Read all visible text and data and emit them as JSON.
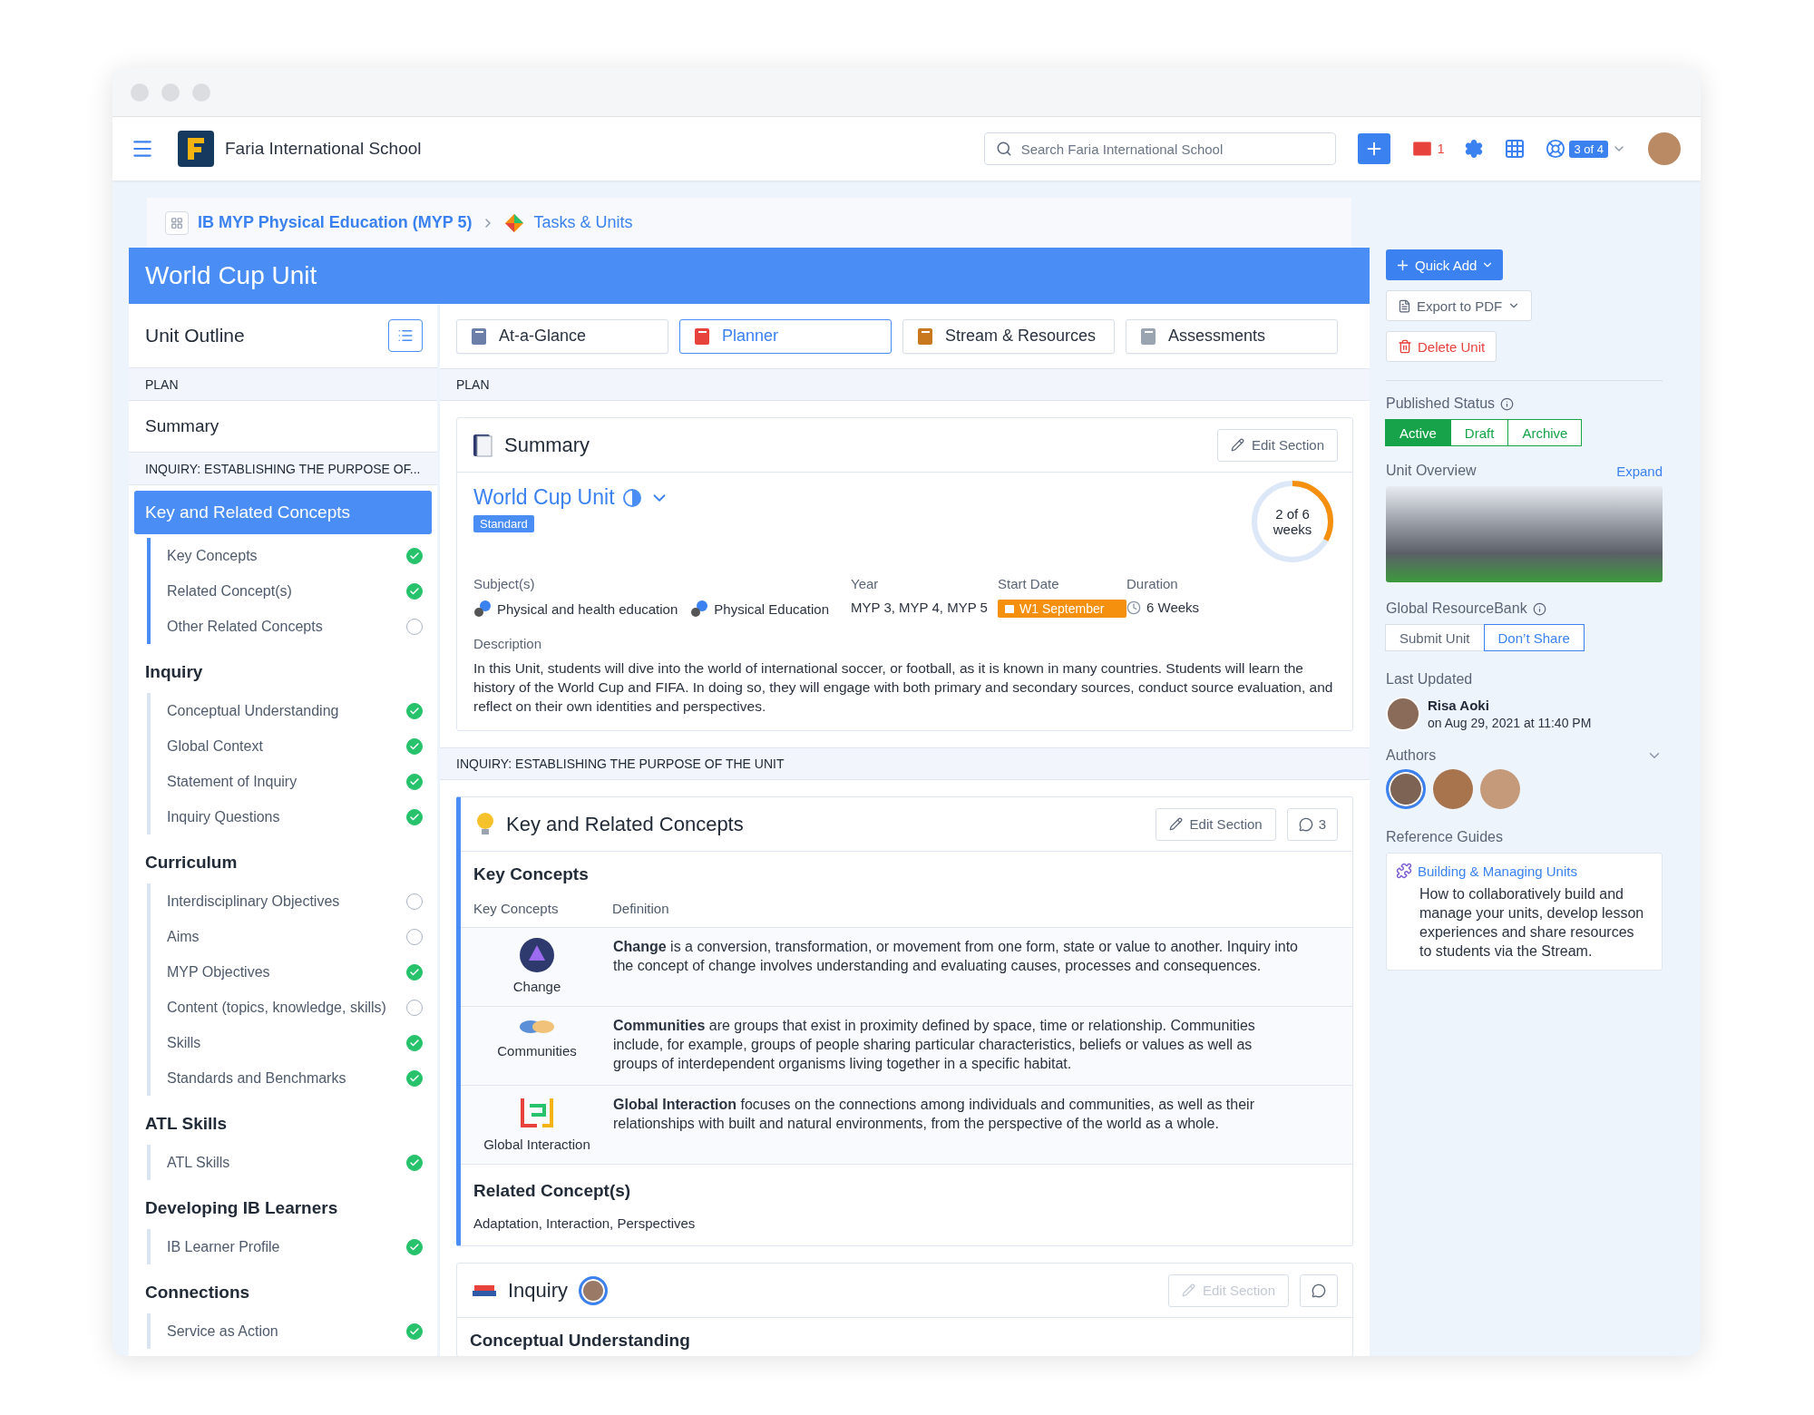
{
  "header": {
    "school": "Faria International School",
    "search": {
      "placeholder": "Search Faria International School"
    },
    "mail_count": "1",
    "account_badge": "3 of 4"
  },
  "breadcrumb": [
    {
      "label": "IB MYP Physical Education (MYP 5)"
    },
    {
      "label": "Tasks & Units"
    }
  ],
  "unit_title": "World Cup Unit",
  "sidebar": {
    "title": "Unit Outline",
    "sections": [
      {
        "kind": "band",
        "label": "PLAN"
      },
      {
        "kind": "link",
        "label": "Summary"
      },
      {
        "kind": "band",
        "label": "INQUIRY: ESTABLISHING THE PURPOSE OF..."
      },
      {
        "kind": "group",
        "label": "Key and Related Concepts",
        "selected": true,
        "children": [
          {
            "label": "Key Concepts",
            "checked": true
          },
          {
            "label": "Related Concept(s)",
            "checked": true
          },
          {
            "label": "Other Related Concepts",
            "checked": false
          }
        ]
      },
      {
        "kind": "group",
        "label": "Inquiry",
        "selected": false,
        "children": [
          {
            "label": "Conceptual Understanding",
            "checked": true
          },
          {
            "label": "Global Context",
            "checked": true
          },
          {
            "label": "Statement of Inquiry",
            "checked": true
          },
          {
            "label": "Inquiry Questions",
            "checked": true
          }
        ]
      },
      {
        "kind": "group",
        "label": "Curriculum",
        "selected": false,
        "children": [
          {
            "label": "Interdisciplinary Objectives",
            "checked": false
          },
          {
            "label": "Aims",
            "checked": false
          },
          {
            "label": "MYP Objectives",
            "checked": true
          },
          {
            "label": "Content (topics, knowledge, skills)",
            "checked": false
          },
          {
            "label": "Skills",
            "checked": true
          },
          {
            "label": "Standards and Benchmarks",
            "checked": true
          }
        ]
      },
      {
        "kind": "group",
        "label": "ATL Skills",
        "selected": false,
        "children": [
          {
            "label": "ATL Skills",
            "checked": true
          }
        ]
      },
      {
        "kind": "group",
        "label": "Developing IB Learners",
        "selected": false,
        "children": [
          {
            "label": "IB Learner Profile",
            "checked": true
          }
        ]
      },
      {
        "kind": "group",
        "label": "Connections",
        "selected": false,
        "children": [
          {
            "label": "Service as Action",
            "checked": true
          }
        ]
      }
    ]
  },
  "tabs": [
    {
      "label": "At-a-Glance",
      "selected": false
    },
    {
      "label": "Planner",
      "selected": true
    },
    {
      "label": "Stream & Resources",
      "selected": false
    },
    {
      "label": "Assessments",
      "selected": false
    }
  ],
  "plan_band": "PLAN",
  "summary": {
    "title": "Summary",
    "edit": "Edit Section",
    "unit_name": "World Cup Unit",
    "tag": "Standard",
    "progress": {
      "count": "2 of 6",
      "unit": "weeks",
      "level": 0.33
    },
    "subjects": {
      "label": "Subject(s)",
      "items": [
        "Physical and health education",
        "Physical Education"
      ]
    },
    "year": {
      "label": "Year",
      "value": "MYP 3, MYP 4, MYP 5"
    },
    "start": {
      "label": "Start Date",
      "value": "W1 September"
    },
    "duration": {
      "label": "Duration",
      "value": "6 Weeks"
    },
    "description": {
      "label": "Description",
      "text": "In this Unit, students will dive into the world of international soccer, or football, as it is known in many countries. Students will learn the history of the World Cup and FIFA. In doing so, they will engage with both primary and secondary sources, conduct source evaluation, and reflect on their own identities and perspectives."
    }
  },
  "inquiry_band": "INQUIRY: ESTABLISHING THE PURPOSE OF THE UNIT",
  "concepts": {
    "title": "Key and Related Concepts",
    "edit": "Edit Section",
    "comments": "3",
    "heading": "Key Concepts",
    "columns": [
      "Key Concepts",
      "Definition"
    ],
    "rows": [
      {
        "name": "Change",
        "definition": "**Change** is a conversion, transformation, or movement from one form, state or value to another. Inquiry into the concept of change involves understanding and evaluating causes, processes and consequences."
      },
      {
        "name": "Communities",
        "definition": "**Communities** are groups that exist in proximity defined by space, time or relationship. Communities include, for example, groups of people sharing particular characteristics, beliefs or values as well as groups of interdependent organisms living together in a specific habitat."
      },
      {
        "name": "Global Interaction",
        "definition": "**Global Interaction** focuses on the connections among individuals and communities, as well as their relationships with built and natural environments, from the perspective of the world as a whole."
      }
    ],
    "related_heading": "Related Concept(s)",
    "related": "Adaptation, Interaction, Perspectives"
  },
  "inquiry": {
    "title": "Inquiry",
    "edit": "Edit Section",
    "edit_disabled": true,
    "heading": "Conceptual Understanding"
  },
  "actions": {
    "quick_add": "Quick Add",
    "export": "Export to PDF",
    "delete": "Delete Unit"
  },
  "published": {
    "label": "Published Status",
    "options": [
      {
        "label": "Active",
        "selected": true
      },
      {
        "label": "Draft",
        "selected": false
      },
      {
        "label": "Archive",
        "selected": false
      }
    ]
  },
  "overview": {
    "label": "Unit Overview",
    "expand": "Expand"
  },
  "resource_bank": {
    "label": "Global ResourceBank",
    "options": [
      {
        "label": "Submit Unit",
        "selected": false
      },
      {
        "label": "Don’t Share",
        "selected": true
      }
    ]
  },
  "last_updated": {
    "label": "Last Updated",
    "name": "Risa Aoki",
    "time": "on Aug 29, 2021 at 11:40 PM"
  },
  "authors": {
    "label": "Authors",
    "people": [
      {
        "selected": true
      },
      {
        "selected": false
      },
      {
        "selected": false
      }
    ]
  },
  "reference": {
    "label": "Reference Guides",
    "link": "Building & Managing Units",
    "text": "How to collaboratively build and manage your units, develop lesson experiences and share resources to students via the Stream."
  }
}
